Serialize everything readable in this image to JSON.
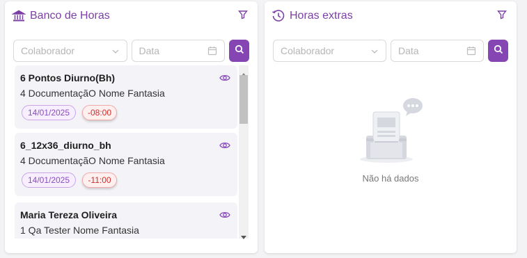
{
  "banco": {
    "title": "Banco de Horas",
    "collaborator_placeholder": "Colaborador",
    "date_placeholder": "Data",
    "cards": [
      {
        "title": "6 Pontos Diurno(Bh)",
        "subtitle": "4 DocumentaçãO Nome Fantasia",
        "date": "14/01/2025",
        "hours": "-08:00"
      },
      {
        "title": "6_12x36_diurno_bh",
        "subtitle": "4 DocumentaçãO Nome Fantasia",
        "date": "14/01/2025",
        "hours": "-11:00"
      },
      {
        "title": "Maria Tereza Oliveira",
        "subtitle": "1 Qa Tester Nome Fantasia"
      }
    ]
  },
  "horas": {
    "title": "Horas extras",
    "collaborator_placeholder": "Colaborador",
    "date_placeholder": "Data",
    "empty_text": "Não há dados"
  },
  "colors": {
    "accent": "#8546b4",
    "title": "#7b3fa6",
    "negative": "#d12a2a"
  },
  "icons": [
    "bank-icon",
    "clock-icon",
    "filter-icon",
    "chevron-down-icon",
    "calendar-icon",
    "search-icon",
    "eye-icon"
  ]
}
